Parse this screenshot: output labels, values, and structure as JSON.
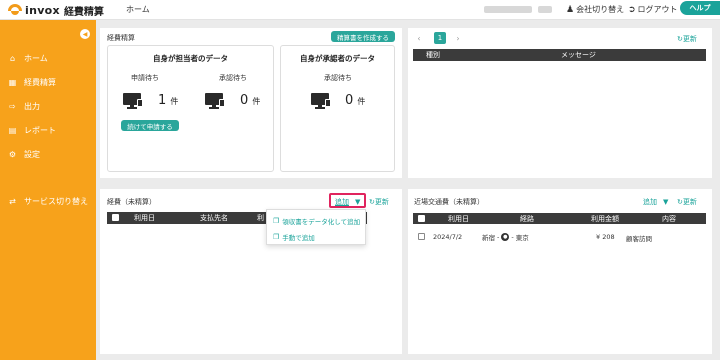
{
  "header": {
    "brand": "invox",
    "product": "経費精算",
    "home": "ホーム",
    "switch_company": "会社切り替え",
    "logout": "ログアウト",
    "help": "ヘルプ"
  },
  "sidebar": {
    "items": [
      {
        "label": "ホーム",
        "icon": "home-icon"
      },
      {
        "label": "経費精算",
        "icon": "document-icon"
      },
      {
        "label": "出力",
        "icon": "export-icon"
      },
      {
        "label": "レポート",
        "icon": "chart-icon"
      },
      {
        "label": "設定",
        "icon": "gear-icon"
      },
      {
        "label": "サービス切り替え",
        "icon": "switch-icon"
      }
    ]
  },
  "expense_panel": {
    "title": "経費精算",
    "create_button": "精算書を作成する",
    "own_card": {
      "title": "自身が担当者のデータ",
      "pending_label": "申請待ち",
      "pending_count": "1",
      "approval_label": "承認待ち",
      "approval_count": "0",
      "unit": "件",
      "continue_button": "続けて申請する"
    },
    "approver_card": {
      "title": "自身が承認者のデータ",
      "approval_label": "承認待ち",
      "approval_count": "0",
      "unit": "件"
    }
  },
  "message_panel": {
    "page": "1",
    "refresh": "更新",
    "columns": [
      "種別",
      "メッセージ"
    ]
  },
  "unsettled_panel": {
    "title": "経費（未精算）",
    "add": "追加",
    "refresh": "更新",
    "columns": [
      "利用日",
      "支払先名",
      "利"
    ],
    "dropdown": [
      {
        "label": "領収書をデータ化して追加",
        "icon": "copy-icon"
      },
      {
        "label": "手動で追加",
        "icon": "copy-icon"
      }
    ]
  },
  "transport_panel": {
    "title": "近場交通費（未精算）",
    "add": "追加",
    "refresh": "更新",
    "columns": [
      "利用日",
      "経路",
      "利用金額",
      "内容"
    ],
    "rows": [
      {
        "date": "2024/7/2",
        "from": "新宿",
        "to": "東京",
        "amount": "¥ 208",
        "content": "顧客訪問"
      }
    ]
  },
  "colors": {
    "accent": "#f7a21b",
    "teal": "#2aa69b",
    "highlight": "#e0245e"
  }
}
